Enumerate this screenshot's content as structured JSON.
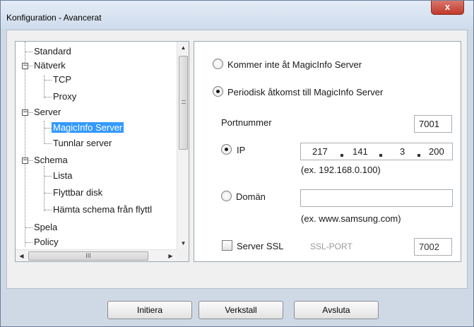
{
  "window": {
    "title": "Konfiguration - Avancerat",
    "close": "x"
  },
  "tree": {
    "items": [
      {
        "label": "Standard",
        "level": 0
      },
      {
        "label": "Nätverk",
        "level": 0,
        "expanded": true
      },
      {
        "label": "TCP",
        "level": 1
      },
      {
        "label": "Proxy",
        "level": 1
      },
      {
        "label": "Server",
        "level": 0,
        "expanded": true
      },
      {
        "label": "MagicInfo Server",
        "level": 1,
        "selected": true
      },
      {
        "label": "Tunnlar server",
        "level": 1
      },
      {
        "label": "Schema",
        "level": 0,
        "expanded": true
      },
      {
        "label": "Lista",
        "level": 1
      },
      {
        "label": "Flyttbar disk",
        "level": 1
      },
      {
        "label": "Hämta schema från flyttl",
        "level": 1
      },
      {
        "label": "Spela",
        "level": 0
      },
      {
        "label": "Policy",
        "level": 0
      }
    ],
    "expander_minus": "−",
    "vscroll_up": "▲",
    "vscroll_down": "▼",
    "hscroll_left": "◀",
    "hscroll_right": "▶",
    "hscroll_grip": "III"
  },
  "settings": {
    "option_no_access": "Kommer inte åt MagicInfo Server",
    "option_periodic": "Periodisk åtkomst till MagicInfo Server",
    "port_label": "Portnummer",
    "port_value": "7001",
    "ip_label": "IP",
    "ip_parts": [
      "217",
      "141",
      "3",
      "200"
    ],
    "ip_example": "(ex. 192.168.0.100)",
    "domain_label": "Domän",
    "domain_value": "",
    "domain_example": "(ex. www.samsung.com)",
    "ssl_label": "Server SSL",
    "ssl_port_label": "SSL-PORT",
    "ssl_port_value": "7002"
  },
  "buttons": {
    "init": "Initiera",
    "apply": "Verkstall",
    "exit": "Avsluta"
  }
}
